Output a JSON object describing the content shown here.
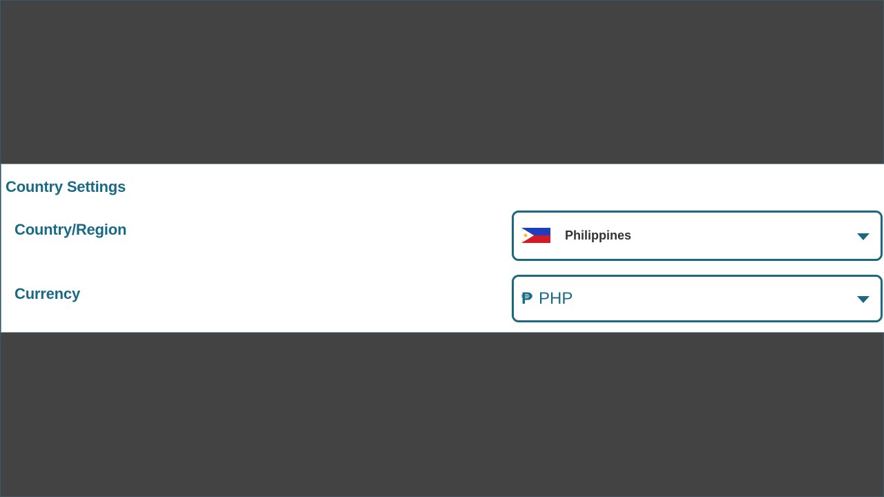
{
  "section": {
    "title": "Country Settings"
  },
  "fields": {
    "country": {
      "label": "Country/Region",
      "value": "Philippines",
      "icon": "philippines-flag-icon"
    },
    "currency": {
      "label": "Currency",
      "symbol": "₱",
      "value": "PHP"
    }
  },
  "colors": {
    "accent": "#1a6a86",
    "border": "#1b6880",
    "background": "#434343",
    "panel": "#ffffff"
  }
}
